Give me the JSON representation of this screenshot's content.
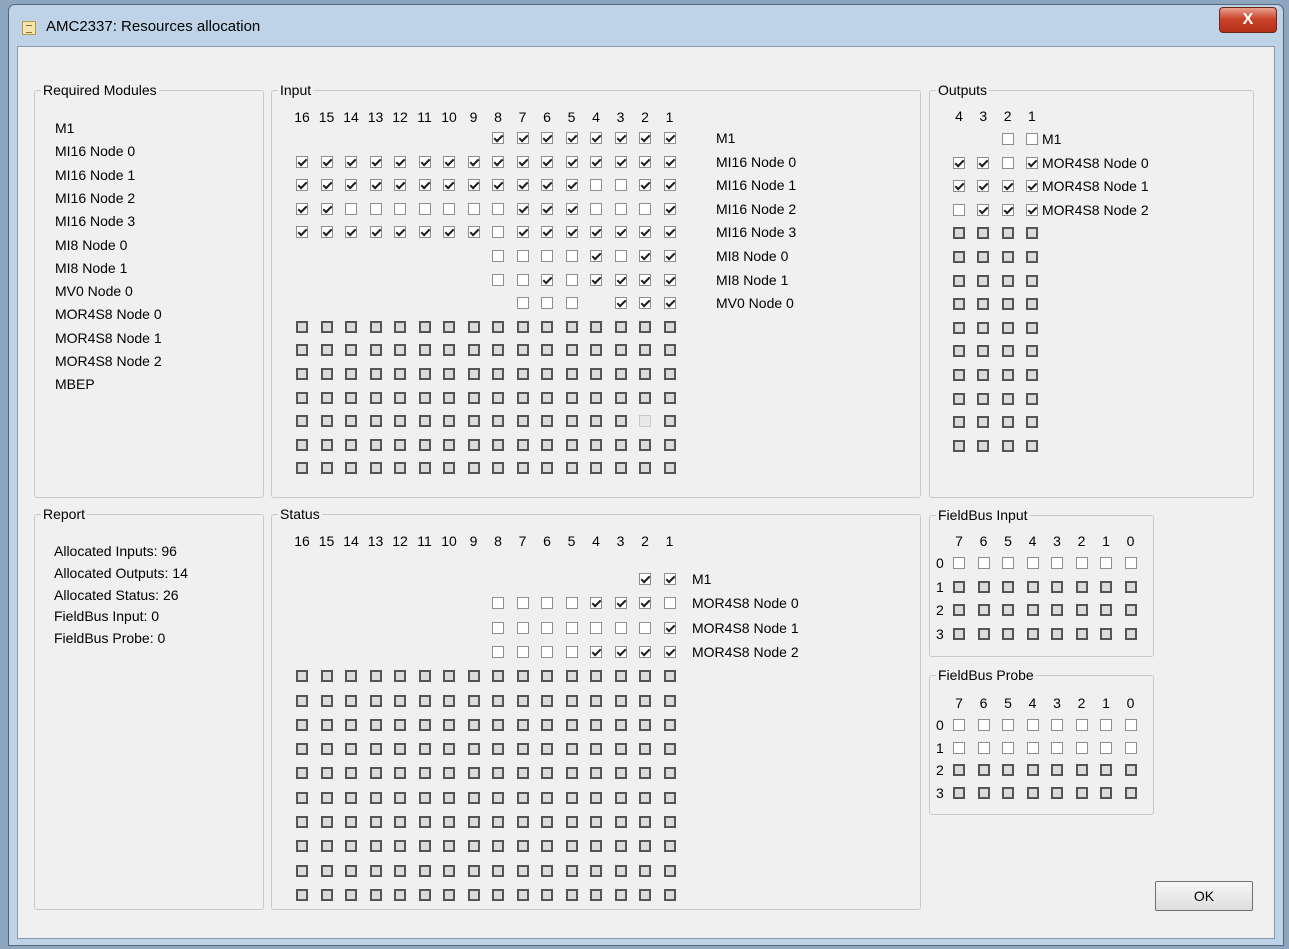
{
  "window": {
    "title": "AMC2337: Resources allocation",
    "close_label": "X"
  },
  "required_modules": {
    "title": "Required Modules",
    "items": [
      "M1",
      "MI16 Node 0",
      "MI16 Node 1",
      "MI16 Node 2",
      "MI16 Node 3",
      "MI8 Node 0",
      "MI8 Node 1",
      "MV0 Node 0",
      "MOR4S8 Node 0",
      "MOR4S8 Node 1",
      "MOR4S8 Node 2",
      "MBEP"
    ]
  },
  "input": {
    "title": "Input",
    "columns": [
      "16",
      "15",
      "14",
      "13",
      "12",
      "11",
      "10",
      "9",
      "8",
      "7",
      "6",
      "5",
      "4",
      "3",
      "2",
      "1"
    ],
    "rows": [
      {
        "label": "M1",
        "cells": "--------XXXXXXXX"
      },
      {
        "label": "MI16 Node 0",
        "cells": "XXXXXXXXXXXXXXXX"
      },
      {
        "label": "MI16 Node 1",
        "cells": "XXXXXXXXXXXXOOXX"
      },
      {
        "label": "MI16 Node 2",
        "cells": "XXOOOOOOOXXXOOOX"
      },
      {
        "label": "MI16 Node 3",
        "cells": "XXXXXXXXOXXXXXXX"
      },
      {
        "label": "MI8 Node 0",
        "cells": "--------OOOOXOXX"
      },
      {
        "label": "MI8 Node 1",
        "cells": "--------OOXOXXXX"
      },
      {
        "label": "MV0 Node 0",
        "cells": "---------OOO-XXX"
      },
      {
        "label": "",
        "cells": "DDDDDDDDDDDDDDDD"
      },
      {
        "label": "",
        "cells": "DDDDDDDDDDDDDDDD"
      },
      {
        "label": "",
        "cells": "DDDDDDDDDDDDDDDD"
      },
      {
        "label": "",
        "cells": "DDDDDDDDDDDDDDDD"
      },
      {
        "label": "",
        "cells": "DDDDDDDDDDDDDDLD"
      },
      {
        "label": "",
        "cells": "DDDDDDDDDDDDDDDD"
      },
      {
        "label": "",
        "cells": "DDDDDDDDDDDDDDDD"
      }
    ]
  },
  "outputs": {
    "title": "Outputs",
    "columns": [
      "4",
      "3",
      "2",
      "1"
    ],
    "rows": [
      {
        "label": "M1",
        "cells": "--OO"
      },
      {
        "label": "MOR4S8 Node 0",
        "cells": "XXOX"
      },
      {
        "label": "MOR4S8 Node 1",
        "cells": "XXXX"
      },
      {
        "label": "MOR4S8 Node 2",
        "cells": "OXXX"
      },
      {
        "label": "",
        "cells": "DDDD"
      },
      {
        "label": "",
        "cells": "DDDD"
      },
      {
        "label": "",
        "cells": "DDDD"
      },
      {
        "label": "",
        "cells": "DDDD"
      },
      {
        "label": "",
        "cells": "DDDD"
      },
      {
        "label": "",
        "cells": "DDDD"
      },
      {
        "label": "",
        "cells": "DDDD"
      },
      {
        "label": "",
        "cells": "DDDD"
      },
      {
        "label": "",
        "cells": "DDDD"
      },
      {
        "label": "",
        "cells": "DDDD"
      }
    ]
  },
  "report": {
    "title": "Report",
    "lines": [
      "Allocated Inputs: 96",
      "Allocated Outputs: 14",
      "Allocated Status: 26",
      "FieldBus Input: 0",
      "FieldBus Probe: 0"
    ]
  },
  "status": {
    "title": "Status",
    "columns": [
      "16",
      "15",
      "14",
      "13",
      "12",
      "11",
      "10",
      "9",
      "8",
      "7",
      "6",
      "5",
      "4",
      "3",
      "2",
      "1"
    ],
    "rows": [
      {
        "label": "M1",
        "cells": "--------------XX"
      },
      {
        "label": "MOR4S8 Node 0",
        "cells": "--------OOOOXXXO"
      },
      {
        "label": "MOR4S8 Node 1",
        "cells": "--------OOOOOOOX"
      },
      {
        "label": "MOR4S8 Node 2",
        "cells": "--------OOOOXXXX"
      },
      {
        "label": "",
        "cells": "DDDDDDDDDDDDDDDD"
      },
      {
        "label": "",
        "cells": "DDDDDDDDDDDDDDDD"
      },
      {
        "label": "",
        "cells": "DDDDDDDDDDDDDDDD"
      },
      {
        "label": "",
        "cells": "DDDDDDDDDDDDDDDD"
      },
      {
        "label": "",
        "cells": "DDDDDDDDDDDDDDDD"
      },
      {
        "label": "",
        "cells": "DDDDDDDDDDDDDDDD"
      },
      {
        "label": "",
        "cells": "DDDDDDDDDDDDDDDD"
      },
      {
        "label": "",
        "cells": "DDDDDDDDDDDDDDDD"
      },
      {
        "label": "",
        "cells": "DDDDDDDDDDDDDDDD"
      },
      {
        "label": "",
        "cells": "DDDDDDDDDDDDDDDD"
      }
    ]
  },
  "fieldbus_input": {
    "title": "FieldBus Input",
    "columns": [
      "7",
      "6",
      "5",
      "4",
      "3",
      "2",
      "1",
      "0"
    ],
    "rows": [
      {
        "label": "0",
        "cells": "OOOOOOOO"
      },
      {
        "label": "1",
        "cells": "DDDDDDDD"
      },
      {
        "label": "2",
        "cells": "DDDDDDDD"
      },
      {
        "label": "3",
        "cells": "DDDDDDDD"
      }
    ]
  },
  "fieldbus_probe": {
    "title": "FieldBus Probe",
    "columns": [
      "7",
      "6",
      "5",
      "4",
      "3",
      "2",
      "1",
      "0"
    ],
    "rows": [
      {
        "label": "0",
        "cells": "OOOOOOOO"
      },
      {
        "label": "1",
        "cells": "OOOOOOOO"
      },
      {
        "label": "2",
        "cells": "DDDDDDDD"
      },
      {
        "label": "3",
        "cells": "DDDDDDDD"
      }
    ]
  },
  "ok_button": {
    "label": "OK"
  }
}
